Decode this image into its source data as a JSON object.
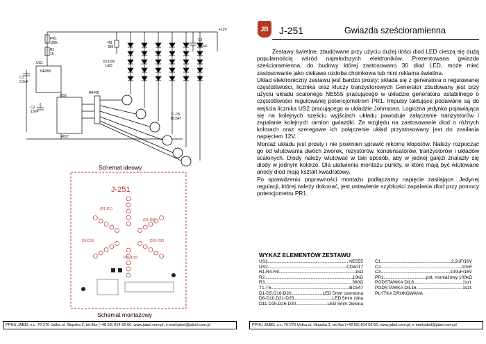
{
  "left": {
    "schematic_caption": "Schemat ideowy",
    "assembly_caption": "Schemat montażowy",
    "pcb_title": "J-251",
    "labels": {
      "pr1": "PR1",
      "pr1_val": "100k",
      "r1": "R1",
      "r1_val": "1k",
      "r3": "R3",
      "r3_val": "360",
      "c1": "C1",
      "c1_val": "2,2uF",
      "c2": "C2",
      "c2_val": "10nF",
      "c3": "C3",
      "c3_val": "100uF",
      "us1": "US1",
      "us1_val": "NE555",
      "us2": "US2",
      "us2_val": "4017",
      "r4r9": "R4-R9",
      "t1t6": "T1-T6",
      "t1t6_val": "BC547",
      "led": "D1-D30",
      "led2": "LED",
      "v12": "+12V",
      "pcb_r1": "(R1-D1)",
      "pcb_d6": "D6-D10",
      "pcb_d26": "D26-D30",
      "pcb_d21": "D21-D25",
      "pcb_d16": "(D1-D5)"
    },
    "footer": "PPHU JABEL s.c. 76-270 Ustka ul. Słupska 3, tel./fax (+48 59) 814 56 66, www.jabel.com.pl, e-mail:jabel@jabel.com.pl"
  },
  "right": {
    "logo": "JB",
    "code": "J-251",
    "title": "Gwiazda sześcioramienna",
    "paragraphs": [
      "Zestawy świetlne, zbudowane przy użyciu dużej ilości diod LED cieszą się dużą popularnością wśród najmłodszych elektroników. Prezentowana gwiazda sześcioramienna, do budowy której zastosowano 30 diod LED, może mieć zastosowanie jako ciekawa ozdoba choinkowa lub mini reklama świetlna.",
      "Układ elektroniczny zestawu jest bardzo prosty: składa się z generatora o regulowanej częstotliwości, licznika oraz kluczy tranzystorowych Generator zbudowany jest przy użyciu układu scalonego NE555 pracującego w układzie generatora astabilnego o częstotliwości regulowanej potencjometrem PR1. Impulsy taktujące podawane są do wejścia licznika US2 pracującego w układzie Johnsona. Logiczna jedynka pojawiająca się na kolejnych sześciu wyjściach układu powoduje załączanie tranzystorów i zapalanie kolejnych ramion gwiazdki. Ze względu na zastosowanie diod o różnych kolorach oraz szeregowe ich połączenie układ przystosowany jest do zasilania napięciem 12V.",
      "Montaż układu jest prosty i nie powinien sprawić nikomu kłopotów. Należy rozpocząć go od wlutowania dwóch zworek, rezystorów, kondensatorów, tranzystorów i układów scalonych. Diody należy wlutować w taki sposób, aby w jednej gałęzi znalazły się diody w jednym kolorze. Dla ułatwienia montażu punkty, w które mają być wlutowane anody diod mają kształt kwadratowy.",
      "Po sprawdzeniu poprawności montażu podłączamy napięcie zasilające. Jedynej regulacji, której należy dokonać, jest ustawienie szybkości zapalania diod przy pomocy potencjometru PR1."
    ],
    "parts_title": "WYKAZ ELEMENTÓW ZESTAWU",
    "parts_left": [
      {
        "name": "US1",
        "value": "NE555"
      },
      {
        "name": "US2",
        "value": "CD4017"
      },
      {
        "name": "R1,R4-R9",
        "value": "1kΩ"
      },
      {
        "name": "R2",
        "value": "10kΩ"
      },
      {
        "name": "R3",
        "value": "360Ω"
      },
      {
        "name": "T1-T6",
        "value": "BC547"
      },
      {
        "name": "D1-D5,D16-D20",
        "value": "LED 5mm czerwona"
      },
      {
        "name": "D6-D10,D21-D25",
        "value": "LED 5mm żółta"
      },
      {
        "name": "D11-D15,D26-D30",
        "value": "LED 5mm zielona"
      }
    ],
    "parts_right": [
      {
        "name": "C1",
        "value": "2,2uF/16V"
      },
      {
        "name": "C2",
        "value": "10nF"
      },
      {
        "name": "C3",
        "value": "100uF/16V"
      },
      {
        "name": "PR1",
        "value": "pot. montażowy 100kΩ"
      },
      {
        "name": "PODSTAWKA DIL8",
        "value": "1szt."
      },
      {
        "name": "PODSTAWKA DIL16",
        "value": "1szt."
      },
      {
        "name": "PŁYTKA DRUKOWANA",
        "value": ""
      }
    ],
    "footer": "PPHU JABEL s.c. 76-270 Ustka ul. Słupska 3, tel./fax (+48 59) 814 56 66, www.jabel.com.pl, e-mail:jabel@jabel.com.pl"
  },
  "colors": {
    "logo": "#b63a22",
    "pcb_trace": "#b43a3a",
    "wire": "#000000"
  }
}
